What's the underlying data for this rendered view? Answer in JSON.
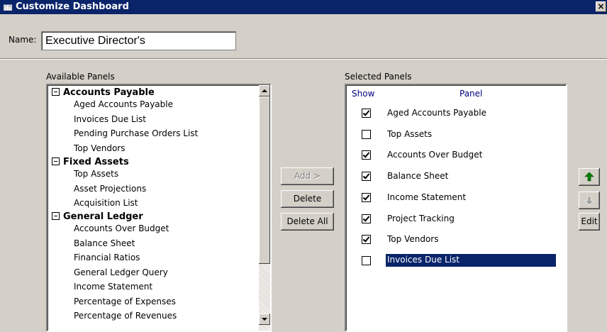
{
  "window": {
    "title": "Customize Dashboard",
    "close_label": "×"
  },
  "name_field": {
    "label": "Name:",
    "value": "Executive Director's"
  },
  "available": {
    "label": "Available Panels",
    "groups": [
      {
        "name": "Accounts Payable",
        "items": [
          "Aged Accounts Payable",
          "Invoices Due List",
          "Pending Purchase Orders List",
          "Top Vendors"
        ]
      },
      {
        "name": "Fixed Assets",
        "items": [
          "Top Assets",
          "Asset Projections",
          "Acquisition List"
        ]
      },
      {
        "name": "General Ledger",
        "items": [
          "Accounts Over Budget",
          "Balance Sheet",
          "Financial Ratios",
          "General Ledger Query",
          "Income Statement",
          "Percentage of Expenses",
          "Percentage of Revenues"
        ]
      }
    ]
  },
  "buttons": {
    "add": "Add >",
    "delete": "Delete",
    "delete_all": "Delete All",
    "edit": "Edit"
  },
  "selected": {
    "label": "Selected Panels",
    "col_show": "Show",
    "col_panel": "Panel",
    "rows": [
      {
        "label": "Aged Accounts Payable",
        "checked": true
      },
      {
        "label": "Top Assets",
        "checked": false
      },
      {
        "label": "Accounts Over Budget",
        "checked": true
      },
      {
        "label": "Balance Sheet",
        "checked": true
      },
      {
        "label": "Income Statement",
        "checked": true
      },
      {
        "label": "Project Tracking",
        "checked": true
      },
      {
        "label": "Top Vendors",
        "checked": true
      },
      {
        "label": "Invoices Due List",
        "checked": false,
        "selected": true
      }
    ]
  },
  "icons": {
    "title": "dashboard-icon",
    "move_up": "arrow-up-icon",
    "move_down": "arrow-down-icon",
    "accent": "#0a246a",
    "arrow_color": "#008000"
  }
}
